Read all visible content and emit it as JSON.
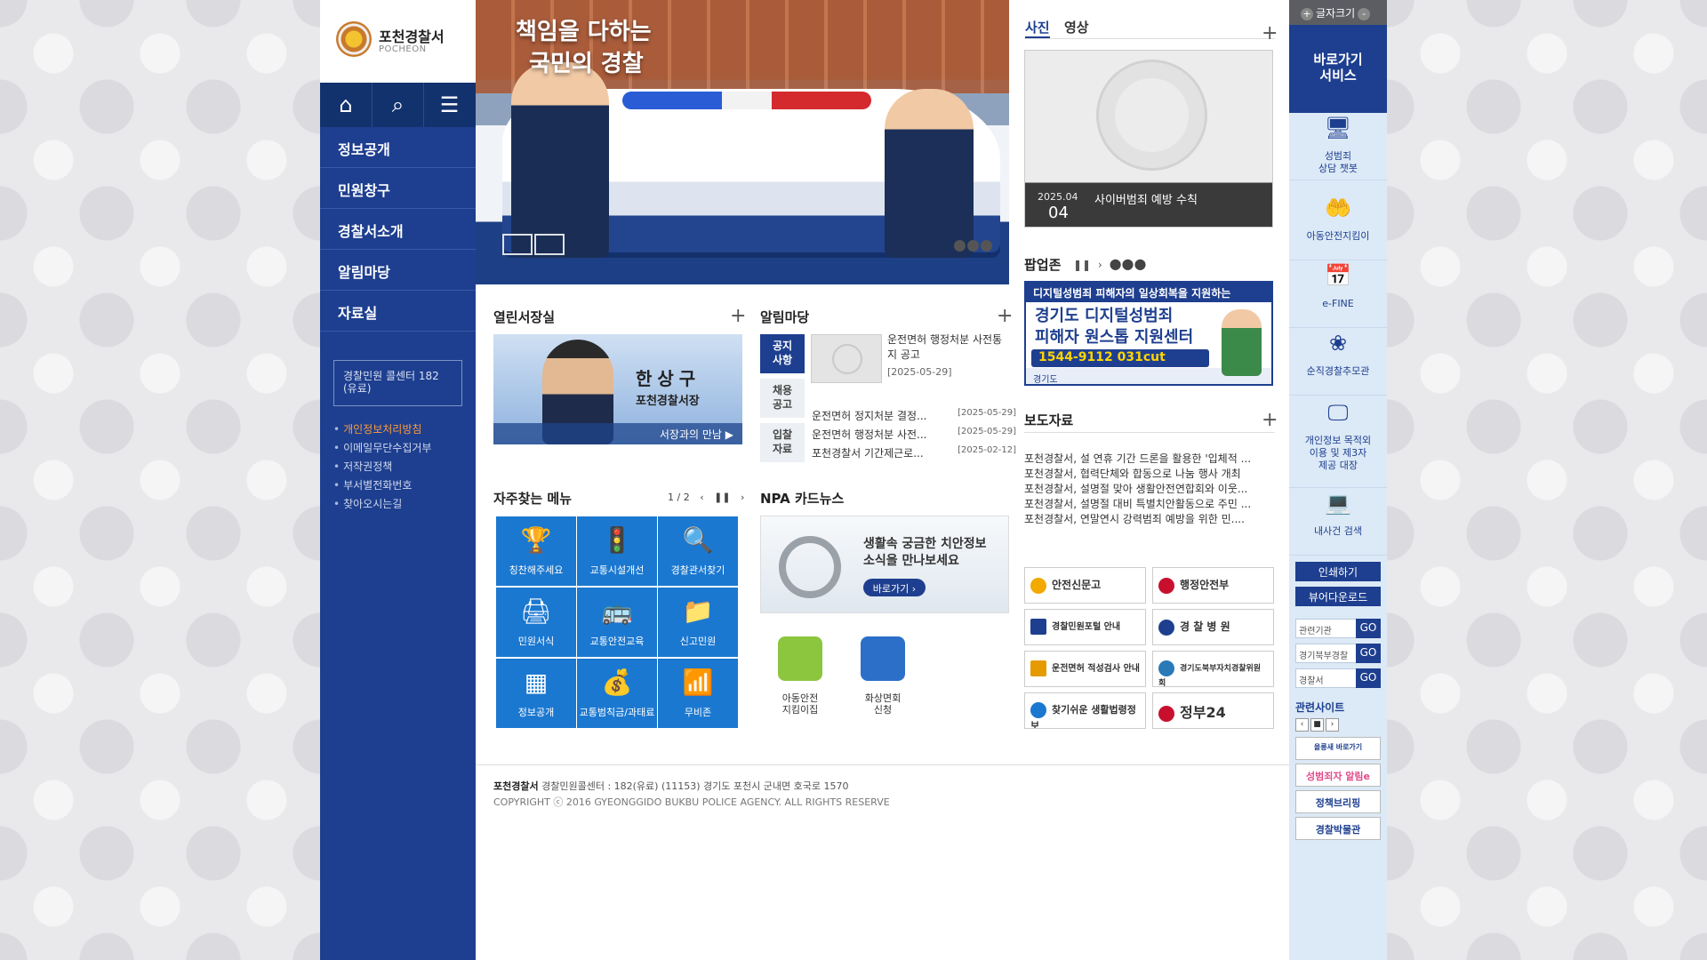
{
  "logo": {
    "title": "포천경찰서",
    "sub": "POCHEON"
  },
  "toolbar": {
    "home_icon": "home-icon",
    "search_icon": "search-icon",
    "menu_icon": "menu-icon"
  },
  "nav": {
    "items": [
      {
        "label": "정보공개"
      },
      {
        "label": "민원창구"
      },
      {
        "label": "경찰서소개"
      },
      {
        "label": "알림마당"
      },
      {
        "label": "자료실"
      }
    ],
    "call_center": "경찰민원 콜센터 182 (유료)",
    "links": [
      "개인정보처리방침",
      "이메일무단수집거부",
      "저작권정책",
      "부서별전화번호",
      "찾아오시는길"
    ]
  },
  "hero": {
    "line1": "책임을 다하는",
    "line2": "국민의 경찰"
  },
  "chief": {
    "section_title": "열린서장실",
    "name": "한상구",
    "role": "포천경찰서장",
    "link": "서장과의 만남 ▶"
  },
  "notice": {
    "section_title": "알림마당",
    "tabs": [
      "공지\n사항",
      "채용\n공고",
      "입찰\n자료"
    ],
    "feature_title": "운전면허 행정처분 사전통지 공고",
    "feature_date": "[2025-05-29]",
    "rows": [
      {
        "title": "운전면허 정지처분 결정...",
        "date": "[2025-05-29]"
      },
      {
        "title": "운전면허 행정처분 사전...",
        "date": "[2025-05-29]"
      },
      {
        "title": "포천경찰서 기간제근로...",
        "date": "[2025-02-12]"
      }
    ]
  },
  "quick": {
    "section_title": "자주찾는 메뉴",
    "pager": "1 / 2",
    "items": [
      {
        "label": "칭찬해주세요",
        "icon": "trophy-icon"
      },
      {
        "label": "교통시설개선",
        "icon": "traffic-icon"
      },
      {
        "label": "경찰관서찾기",
        "icon": "search-icon"
      },
      {
        "label": "민원서식",
        "icon": "form-icon"
      },
      {
        "label": "교통안전교육",
        "icon": "bus-icon"
      },
      {
        "label": "신고민원",
        "icon": "folder-icon"
      },
      {
        "label": "정보공개",
        "icon": "info-icon"
      },
      {
        "label": "교통범칙금/과태료",
        "icon": "fine-icon"
      },
      {
        "label": "무비존",
        "icon": "wifi-icon"
      }
    ]
  },
  "npa": {
    "section_title": "NPA 카드뉴스",
    "text1": "생활속 궁금한 치안정보",
    "text2": "소식을 만나보세요",
    "button": "바로가기 ›"
  },
  "apps": [
    {
      "label": "아동안전\n지킴이집",
      "color": "#8cc63f"
    },
    {
      "label": "화상면회\n신청",
      "color": "#2b6fc9"
    }
  ],
  "media": {
    "tab_photo": "사진",
    "tab_video": "영상",
    "date_month": "2025.04",
    "date_day": "04",
    "caption": "사이버범죄 예방 수칙"
  },
  "popup": {
    "title": "팝업존",
    "b1": "디지털성범죄 피해자의 일상회복을 지원하는",
    "b2a": "경기도 디지털성범죄",
    "b2b": "피해자 원스톱 지원센터",
    "b3": "1544-9112 031cut",
    "b4": "경기도"
  },
  "press": {
    "section_title": "보도자료",
    "rows": [
      "포천경찰서, 설 연휴 기간 드론을 활용한 '입체적 ...",
      "포천경찰서, 협력단체와 합동으로 나눔 행사 개최",
      "포천경찰서, 설명절 맞아 생활안전연합회와 이웃...",
      "포천경찰서, 설명절 대비 특별치안활동으로 주민 ...",
      "포천경찰서, 연말연시 강력범죄 예방을 위한 민...."
    ]
  },
  "banners": [
    {
      "label": "안전신문고",
      "color": "#f2a900"
    },
    {
      "label": "행정안전부",
      "color": "#c8102e"
    },
    {
      "label": "경찰민원포털 안내",
      "color": "#1e3f8f"
    },
    {
      "label": "경 찰 병 원",
      "color": "#1e3f8f"
    },
    {
      "label": "운전면허 적성검사 안내",
      "color": "#e59b00"
    },
    {
      "label": "경기도북부자치경찰위원회",
      "color": "#2a7ab8"
    },
    {
      "label": "찾기쉬운 생활법령정보",
      "color": "#1b78d0"
    },
    {
      "label": "정부24",
      "color": "#c8102e"
    }
  ],
  "rside": {
    "fontsize": "글자크기",
    "shortcut": "바로가기\n서비스",
    "items": [
      {
        "label": "성범죄\n상담 챗봇",
        "icon": "monitor-icon"
      },
      {
        "label": "아동안전지킴이",
        "icon": "hand-icon"
      },
      {
        "label": "e-FINE",
        "icon": "calendar-icon"
      },
      {
        "label": "순직경찰추모관",
        "icon": "flower-icon"
      },
      {
        "label": "개인정보 목적외\n이용 및 제3자\n제공 대장",
        "icon": "screen-icon"
      },
      {
        "label": "내사건 검색",
        "icon": "laptop-icon"
      }
    ],
    "print": "인쇄하기",
    "viewer": "뷰어다운로드",
    "selects": [
      "관련기관",
      "경기북부경찰",
      "경찰서"
    ],
    "go": "GO",
    "related_title": "관련사이트",
    "related": [
      "을릉새 바로가기",
      "성범죄자 알림e",
      "정책브리핑",
      "경찰박물관"
    ]
  }
}
